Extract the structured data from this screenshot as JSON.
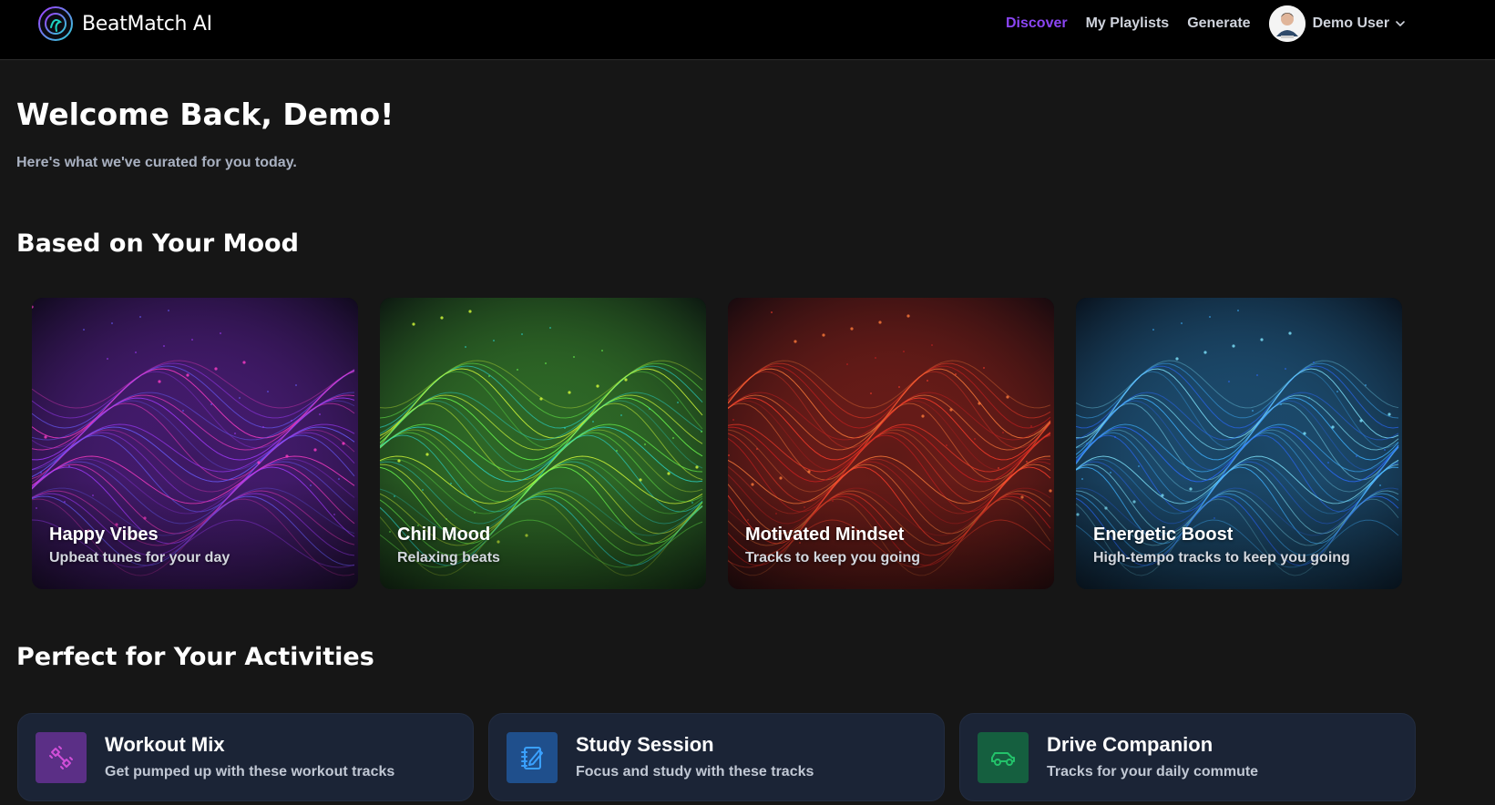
{
  "app": {
    "name": "BeatMatch AI"
  },
  "nav": {
    "links": [
      {
        "label": "Discover",
        "active": true
      },
      {
        "label": "My Playlists",
        "active": false
      },
      {
        "label": "Generate",
        "active": false
      }
    ],
    "user": {
      "name": "Demo User",
      "icon": "chevron-down-icon"
    }
  },
  "header": {
    "welcome": "Welcome Back, Demo!",
    "subtitle": "Here's what we've curated for you today."
  },
  "mood_section": {
    "title": "Based on Your Mood",
    "cards": [
      {
        "title": "Happy Vibes",
        "description": "Upbeat tunes for your day",
        "theme": [
          "#ff3cc8",
          "#a23bff",
          "#6a5cff"
        ]
      },
      {
        "title": "Chill Mood",
        "description": "Relaxing beats",
        "theme": [
          "#d7ff3a",
          "#6dff4f",
          "#2ad4c8"
        ]
      },
      {
        "title": "Motivated Mindset",
        "description": "Tracks to keep you going",
        "theme": [
          "#ff7a3a",
          "#ff3d2a",
          "#c81f1f"
        ]
      },
      {
        "title": "Energetic Boost",
        "description": "High-tempo tracks to keep you going",
        "theme": [
          "#7fe6ff",
          "#3fb2ff",
          "#2a6cff"
        ]
      }
    ]
  },
  "activities_section": {
    "title": "Perfect for Your Activities",
    "cards": [
      {
        "title": "Workout Mix",
        "description": "Get pumped up with these workout tracks",
        "icon": "dumbbell-icon",
        "icon_bg": "#5b2f86",
        "icon_color": "#d14fd8"
      },
      {
        "title": "Study Session",
        "description": "Focus and study with these tracks",
        "icon": "notebook-pencil-icon",
        "icon_bg": "#1f4f8c",
        "icon_color": "#3aa0ff"
      },
      {
        "title": "Drive Companion",
        "description": "Tracks for your daily commute",
        "icon": "car-icon",
        "icon_bg": "#155f3f",
        "icon_color": "#23c26a"
      }
    ]
  },
  "colors": {
    "accent": "#8b45f3",
    "background": "#161616",
    "card_bg": "#1b2436"
  }
}
